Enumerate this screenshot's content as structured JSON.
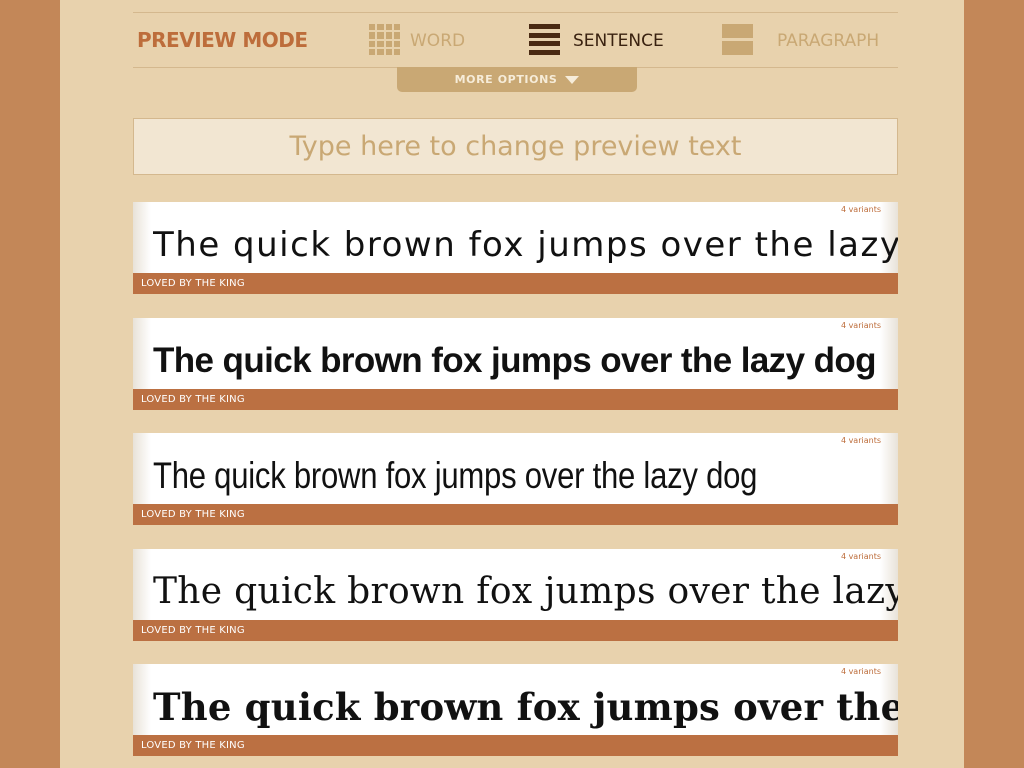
{
  "mode_bar": {
    "title": "PREVIEW MODE",
    "modes": [
      {
        "label": "WORD",
        "icon": "grid-icon"
      },
      {
        "label": "SENTENCE",
        "icon": "lines-icon",
        "active": true
      },
      {
        "label": "PARAGRAPH",
        "icon": "paragraph-icon"
      }
    ],
    "more_options": "MORE OPTIONS"
  },
  "preview_input": {
    "placeholder": "Type here to change preview text",
    "value": ""
  },
  "fonts": [
    {
      "variants": "4 variants",
      "sample": "The quick brown fox jumps over the lazy dog",
      "footer": "LOVED BY THE KING"
    },
    {
      "variants": "4 variants",
      "sample": "The quick brown fox jumps over the lazy dog",
      "footer": "LOVED BY THE KING"
    },
    {
      "variants": "4 variants",
      "sample": "The quick brown fox jumps over the lazy dog",
      "footer": "LOVED BY THE KING"
    },
    {
      "variants": "4 variants",
      "sample": "The quick brown fox jumps over the lazy dog",
      "footer": "LOVED BY THE KING"
    },
    {
      "variants": "4 variants",
      "sample": "The quick brown fox jumps over the lazy dog",
      "footer": "LOVED BY THE KING"
    }
  ],
  "colors": {
    "background": "#c38758",
    "panel": "#e8d2ad",
    "accent": "#bd6d3b",
    "footer_bar": "#bb7042",
    "muted": "#c9a874",
    "active_text": "#3a2210"
  }
}
